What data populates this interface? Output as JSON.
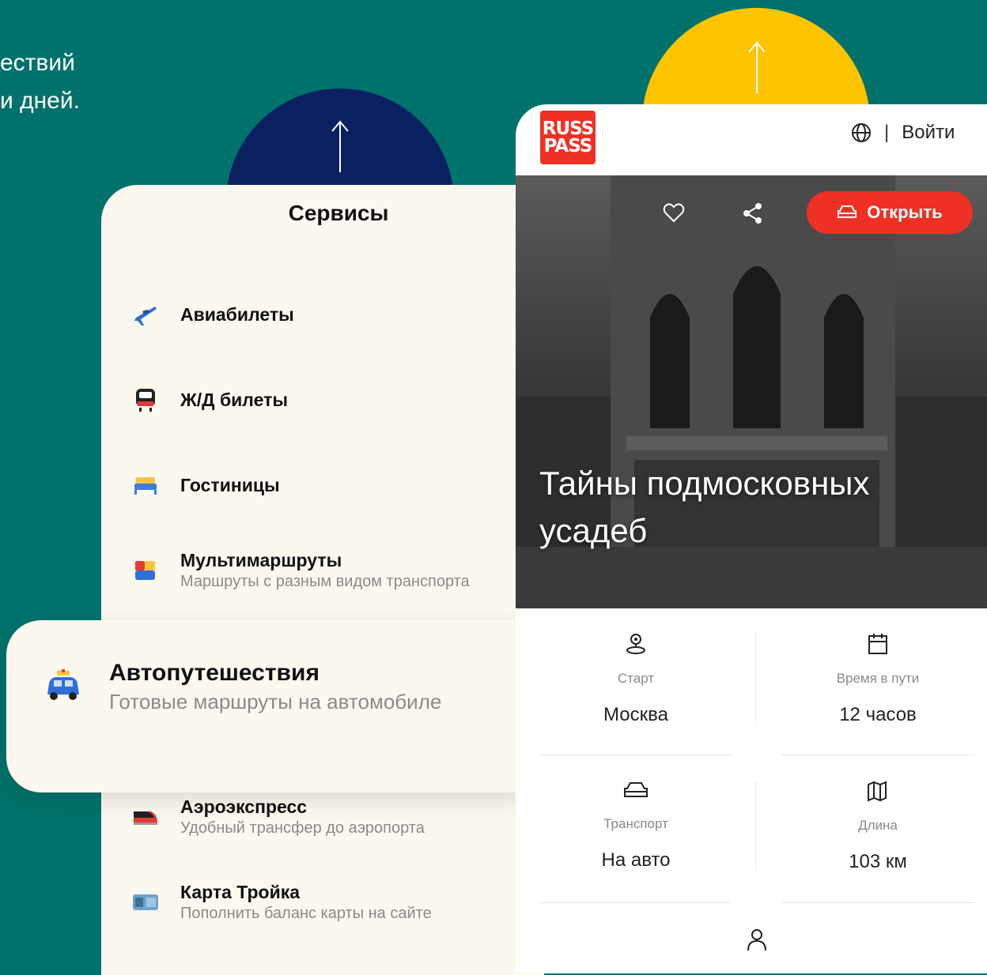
{
  "intro": {
    "text": "ествий\nи дней."
  },
  "services": {
    "title": "Сервисы",
    "items": [
      {
        "title": "Авиабилеты",
        "subtitle": "",
        "icon": "airplane-icon"
      },
      {
        "title": "Ж/Д билеты",
        "subtitle": "",
        "icon": "train-icon"
      },
      {
        "title": "Гостиницы",
        "subtitle": "",
        "icon": "bed-icon"
      },
      {
        "title": "Мультимаршруты",
        "subtitle": "Маршруты с разным видом транспорта",
        "icon": "multiroute-icon"
      },
      {
        "title": "Аэроэкспресс",
        "subtitle": "Удобный трансфер до аэропорта",
        "icon": "aeroexpress-icon"
      },
      {
        "title": "Карта Тройка",
        "subtitle": "Пополнить баланс карты на сайте",
        "icon": "troika-card-icon"
      }
    ]
  },
  "highlight": {
    "title": "Автопутешествия",
    "subtitle": "Готовые маршруты на автомобиле",
    "icon": "car-trip-icon"
  },
  "app": {
    "logo_line1": "RUSS",
    "logo_line2": "PASS",
    "separator": "|",
    "login": "Войти",
    "open_button": "Открыть",
    "hero_title": "Тайны подмосковных\nусадеб",
    "info": [
      {
        "label": "Старт",
        "value": "Москва",
        "icon": "location-pin-icon"
      },
      {
        "label": "Время в пути",
        "value": "12 часов",
        "icon": "calendar-icon"
      },
      {
        "label": "Транспорт",
        "value": "На авто",
        "icon": "car-icon"
      },
      {
        "label": "Длина",
        "value": "103 км",
        "icon": "map-icon"
      }
    ]
  },
  "colors": {
    "background": "#00726b",
    "navy": "#0a2060",
    "yellow": "#ffc400",
    "accent_red": "#ee3124",
    "panel": "#fcf8ef"
  }
}
